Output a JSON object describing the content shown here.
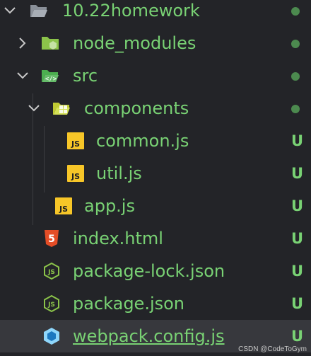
{
  "explorer": {
    "root": {
      "label": "10.22homework",
      "icon": "folder-open-icon"
    },
    "items": [
      {
        "label": "node_modules",
        "icon": "folder-node-icon"
      },
      {
        "label": "src",
        "icon": "folder-src-icon"
      },
      {
        "label": "components",
        "icon": "folder-components-icon"
      },
      {
        "label": "common.js",
        "icon": "js-icon",
        "status": "U"
      },
      {
        "label": "util.js",
        "icon": "js-icon",
        "status": "U"
      },
      {
        "label": "app.js",
        "icon": "js-icon",
        "status": "U"
      },
      {
        "label": "index.html",
        "icon": "html5-icon",
        "status": "U"
      },
      {
        "label": "package-lock.json",
        "icon": "nodejs-icon",
        "status": "U"
      },
      {
        "label": "package.json",
        "icon": "nodejs-icon",
        "status": "U"
      },
      {
        "label": "webpack.config.js",
        "icon": "webpack-icon",
        "status": "U"
      }
    ]
  },
  "watermark": "CSDN @CodeToGym",
  "colors": {
    "untracked": "#79d274",
    "selected_row": "#37383d",
    "background": "#232428"
  }
}
